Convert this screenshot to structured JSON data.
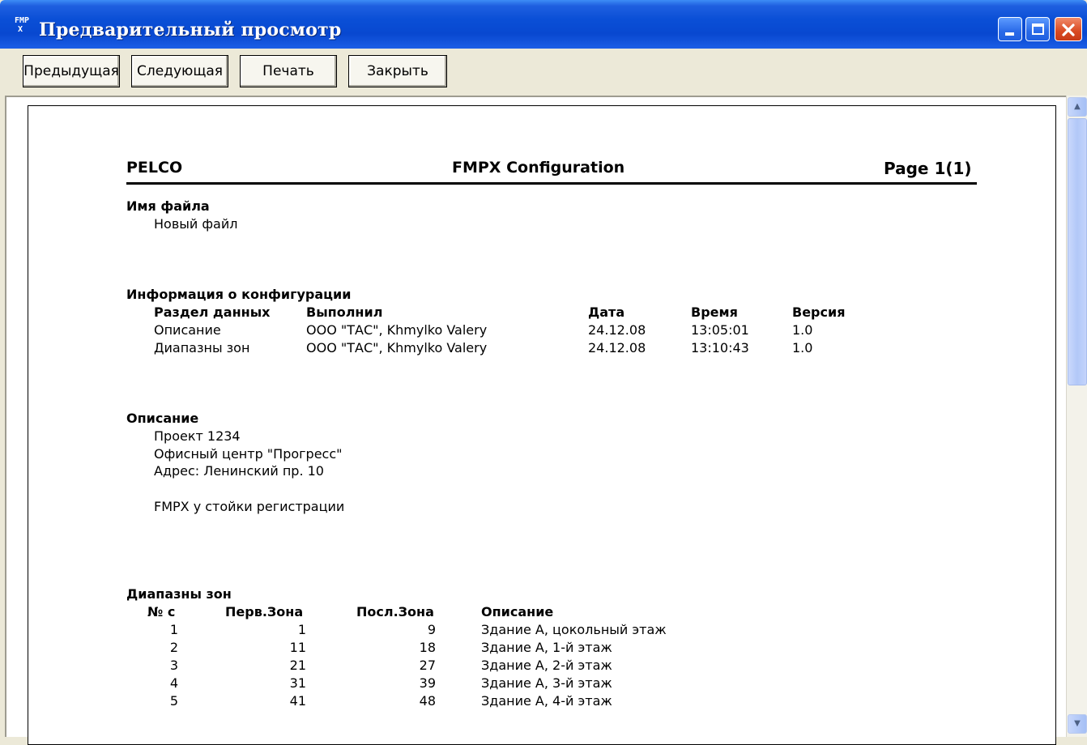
{
  "window": {
    "icon_text_top": "FMP",
    "icon_text_bottom": "X",
    "title": "Предварительный просмотр"
  },
  "toolbar": {
    "prev_label": "Предыдущая",
    "next_label": "Следующая",
    "print_label": "Печать",
    "close_label": "Закрыть"
  },
  "report": {
    "header": {
      "company": "PELCO",
      "title": "FMPX Configuration",
      "page": "Page 1(1)"
    },
    "file_section": {
      "title": "Имя файла",
      "value": "Новый файл"
    },
    "config_section": {
      "title": "Информация о конфигурации",
      "columns": [
        "Раздел данных",
        "Выполнил",
        "Дата",
        "Время",
        "Версия"
      ],
      "rows": [
        [
          "Описание",
          "ООО \"ТАС\", Khmylko Valery",
          "24.12.08",
          "13:05:01",
          "1.0"
        ],
        [
          "Диапазны зон",
          "ООО \"ТАС\", Khmylko Valery",
          "24.12.08",
          "13:10:43",
          "1.0"
        ]
      ]
    },
    "description_section": {
      "title": "Описание",
      "lines": [
        "Проект 1234",
        "Офисный центр \"Прогресс\"",
        "Адрес: Ленинский пр. 10",
        "",
        "FMPX у стойки регистрации"
      ]
    },
    "zones_section": {
      "title": "Диапазны зон",
      "columns": [
        "№ с",
        "Перв.Зона",
        "Посл.Зона",
        "Описание"
      ],
      "rows": [
        [
          "1",
          "1",
          "9",
          "Здание А, цокольный этаж"
        ],
        [
          "2",
          "11",
          "18",
          "Здание А, 1-й этаж"
        ],
        [
          "3",
          "21",
          "27",
          "Здание А, 2-й этаж"
        ],
        [
          "4",
          "31",
          "39",
          "Здание А, 3-й этаж"
        ],
        [
          "5",
          "41",
          "48",
          "Здание А, 4-й этаж"
        ]
      ]
    }
  }
}
